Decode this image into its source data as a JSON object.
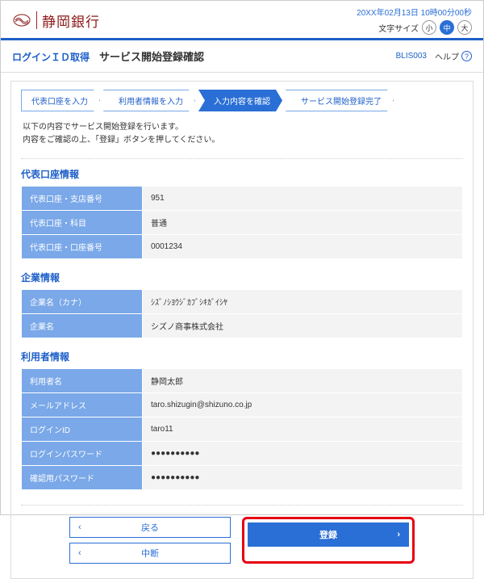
{
  "header": {
    "bank_name": "静岡銀行",
    "timestamp": "20XX年02月13日 10時00分00秒",
    "fontsize_label": "文字サイズ",
    "fs_small": "小",
    "fs_med": "中",
    "fs_large": "大"
  },
  "title": {
    "context": "ログインＩＤ取得",
    "page": "サービス開始登録確認",
    "screen_id": "BLIS003",
    "help": "ヘルプ"
  },
  "wizard": {
    "s1": "代表口座を入力",
    "s2": "利用者情報を入力",
    "s3": "入力内容を確認",
    "s4": "サービス開始登録完了"
  },
  "intro": {
    "l1": "以下の内容でサービス開始登録を行います。",
    "l2": "内容をご確認の上、「登録」ボタンを押してください。"
  },
  "sect1": {
    "title": "代表口座情報",
    "k1": "代表口座・支店番号",
    "v1": "951",
    "k2": "代表口座・科目",
    "v2": "普通",
    "k3": "代表口座・口座番号",
    "v3": "0001234"
  },
  "sect2": {
    "title": "企業情報",
    "k1": "企業名（カナ）",
    "v1": "ｼｽﾞﾉｼﾖｳｼﾞｶﾌﾞｼｷｶﾞｲｼﾔ",
    "k2": "企業名",
    "v2": "シズノ商事株式会社"
  },
  "sect3": {
    "title": "利用者情報",
    "k1": "利用者名",
    "v1": "静岡太郎",
    "k2": "メールアドレス",
    "v2": "taro.shizugin@shizuno.co.jp",
    "k3": "ログインID",
    "v3": "taro11",
    "k4": "ログインパスワード",
    "v4": "●●●●●●●●●●",
    "k5": "確認用パスワード",
    "v5": "●●●●●●●●●●"
  },
  "actions": {
    "back": "戻る",
    "cancel": "中断",
    "submit": "登録"
  }
}
